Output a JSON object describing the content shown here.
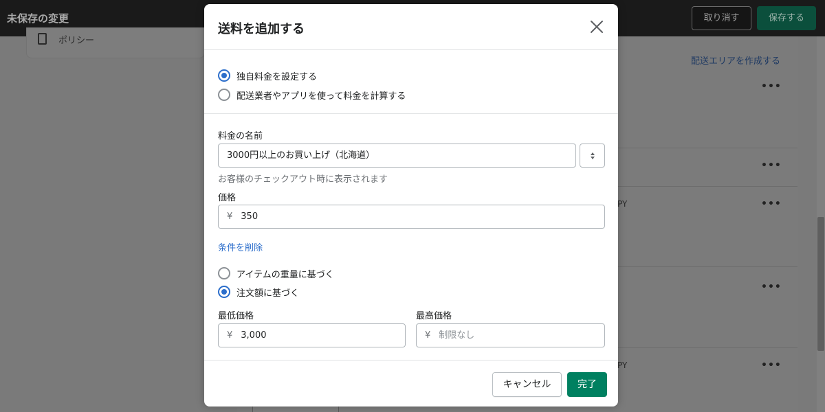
{
  "topbar": {
    "title": "未保存の変更",
    "discard_label": "取り消す",
    "save_label": "保存する"
  },
  "background": {
    "policy_label": "ポリシー",
    "create_area_link": "配送エリアを作成する",
    "row_text_1": "PY",
    "row_text_2": "PY"
  },
  "modal": {
    "title": "送料を追加する",
    "rate_type_options": [
      {
        "label": "独自料金を設定する",
        "checked": true
      },
      {
        "label": "配送業者やアプリを使って料金を計算する",
        "checked": false
      }
    ],
    "rate_name": {
      "label": "料金の名前",
      "value": "3000円以上のお買い上げ（北海道）",
      "help_text": "お客様のチェックアウト時に表示されます"
    },
    "price": {
      "label": "価格",
      "currency": "¥",
      "value": "350"
    },
    "remove_conditions_link": "条件を削除",
    "condition_options": [
      {
        "label": "アイテムの重量に基づく",
        "checked": false
      },
      {
        "label": "注文額に基づく",
        "checked": true
      }
    ],
    "min_price": {
      "label": "最低価格",
      "currency": "¥",
      "value": "3,000"
    },
    "max_price": {
      "label": "最高価格",
      "currency": "¥",
      "placeholder": "制限なし"
    },
    "cancel_label": "キャンセル",
    "done_label": "完了"
  },
  "colors": {
    "primary_green": "#008060",
    "accent_blue": "#2c6ecb",
    "topbar_bg": "#1a1a1a"
  }
}
